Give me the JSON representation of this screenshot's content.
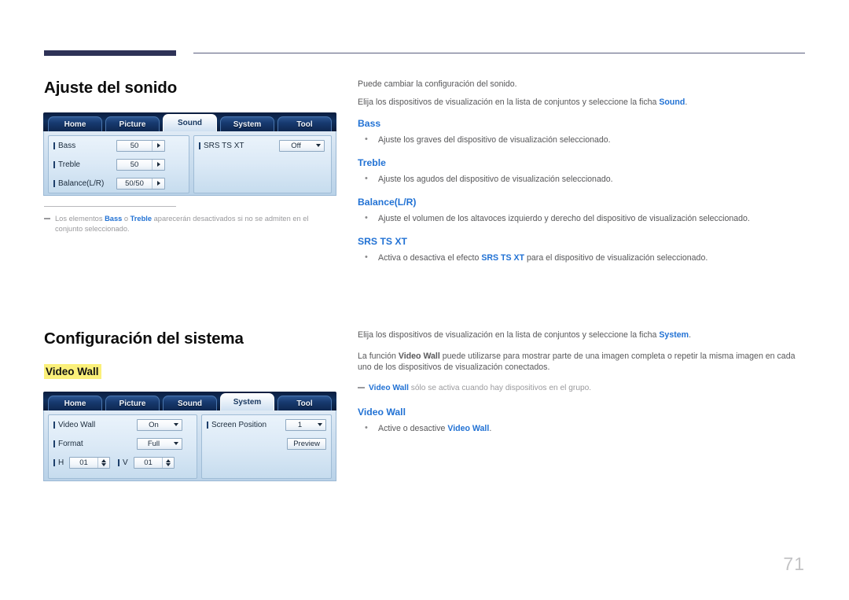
{
  "page": {
    "number": "71"
  },
  "sound_section": {
    "title": "Ajuste del sonido",
    "intro_1": "Puede cambiar la configuración del sonido.",
    "intro_2_pre": "Elija los dispositivos de visualización en la lista de conjuntos y seleccione la ficha ",
    "intro_2_bold": "Sound",
    "intro_2_post": ".",
    "items": [
      {
        "heading": "Bass",
        "bullet": "Ajuste los graves del dispositivo de visualización seleccionado."
      },
      {
        "heading": "Treble",
        "bullet": "Ajuste los agudos del dispositivo de visualización seleccionado."
      },
      {
        "heading": "Balance(L/R)",
        "bullet": "Ajuste el volumen de los altavoces izquierdo y derecho del dispositivo de visualización seleccionado."
      },
      {
        "heading": "SRS TS XT",
        "bullet_pre": "Activa o desactiva el efecto ",
        "bullet_bold": "SRS TS XT",
        "bullet_post": " para el dispositivo de visualización seleccionado."
      }
    ],
    "footnote": {
      "pre": "Los elementos ",
      "bold_1": "Bass",
      "mid": " o ",
      "bold_2": "Treble",
      "post": " aparecerán desactivados si no se admiten en el conjunto seleccionado."
    }
  },
  "sound_panel": {
    "tabs": [
      {
        "label": "Home",
        "active": false
      },
      {
        "label": "Picture",
        "active": false
      },
      {
        "label": "Sound",
        "active": true
      },
      {
        "label": "System",
        "active": false
      },
      {
        "label": "Tool",
        "active": false
      }
    ],
    "left_rows": [
      {
        "label": "Bass",
        "value": "50",
        "control": "arrow-right"
      },
      {
        "label": "Treble",
        "value": "50",
        "control": "arrow-right"
      },
      {
        "label": "Balance(L/R)",
        "value": "50/50",
        "control": "arrow-right"
      }
    ],
    "right_rows": [
      {
        "label": "SRS TS XT",
        "value": "Off",
        "control": "dropdown"
      }
    ]
  },
  "system_section": {
    "title": "Configuración del sistema",
    "sub_heading": "Video Wall",
    "intro_1_pre": "Elija los dispositivos de visualización en la lista de conjuntos y seleccione la ficha ",
    "intro_1_bold": "System",
    "intro_1_post": ".",
    "intro_2_pre": "La función ",
    "intro_2_bold": "Video Wall",
    "intro_2_post": " puede utilizarse para mostrar parte de una imagen completa o repetir la misma imagen en cada uno de los dispositivos de visualización conectados.",
    "note_bold": "Video Wall",
    "note_post": " sólo se activa cuando hay dispositivos en el grupo.",
    "item": {
      "heading": "Video Wall",
      "bullet_pre": "Active o desactive ",
      "bullet_bold": "Video Wall",
      "bullet_post": "."
    }
  },
  "system_panel": {
    "tabs": [
      {
        "label": "Home",
        "active": false
      },
      {
        "label": "Picture",
        "active": false
      },
      {
        "label": "Sound",
        "active": false
      },
      {
        "label": "System",
        "active": true
      },
      {
        "label": "Tool",
        "active": false
      }
    ],
    "left_rows": [
      {
        "label": "Video Wall",
        "value": "On",
        "control": "dropdown"
      },
      {
        "label": "Format",
        "value": "Full",
        "control": "dropdown"
      }
    ],
    "grid_row": {
      "h_label": "H",
      "h_value": "01",
      "v_label": "V",
      "v_value": "01"
    },
    "right_rows": [
      {
        "label": "Screen Position",
        "value": "1",
        "control": "dropdown"
      }
    ],
    "preview_button": "Preview"
  },
  "colors": {
    "accent_blue": "#2272d4",
    "highlight_yellow": "#fbf07a",
    "header_navy": "#2e3257",
    "body_gray": "#58585a"
  }
}
